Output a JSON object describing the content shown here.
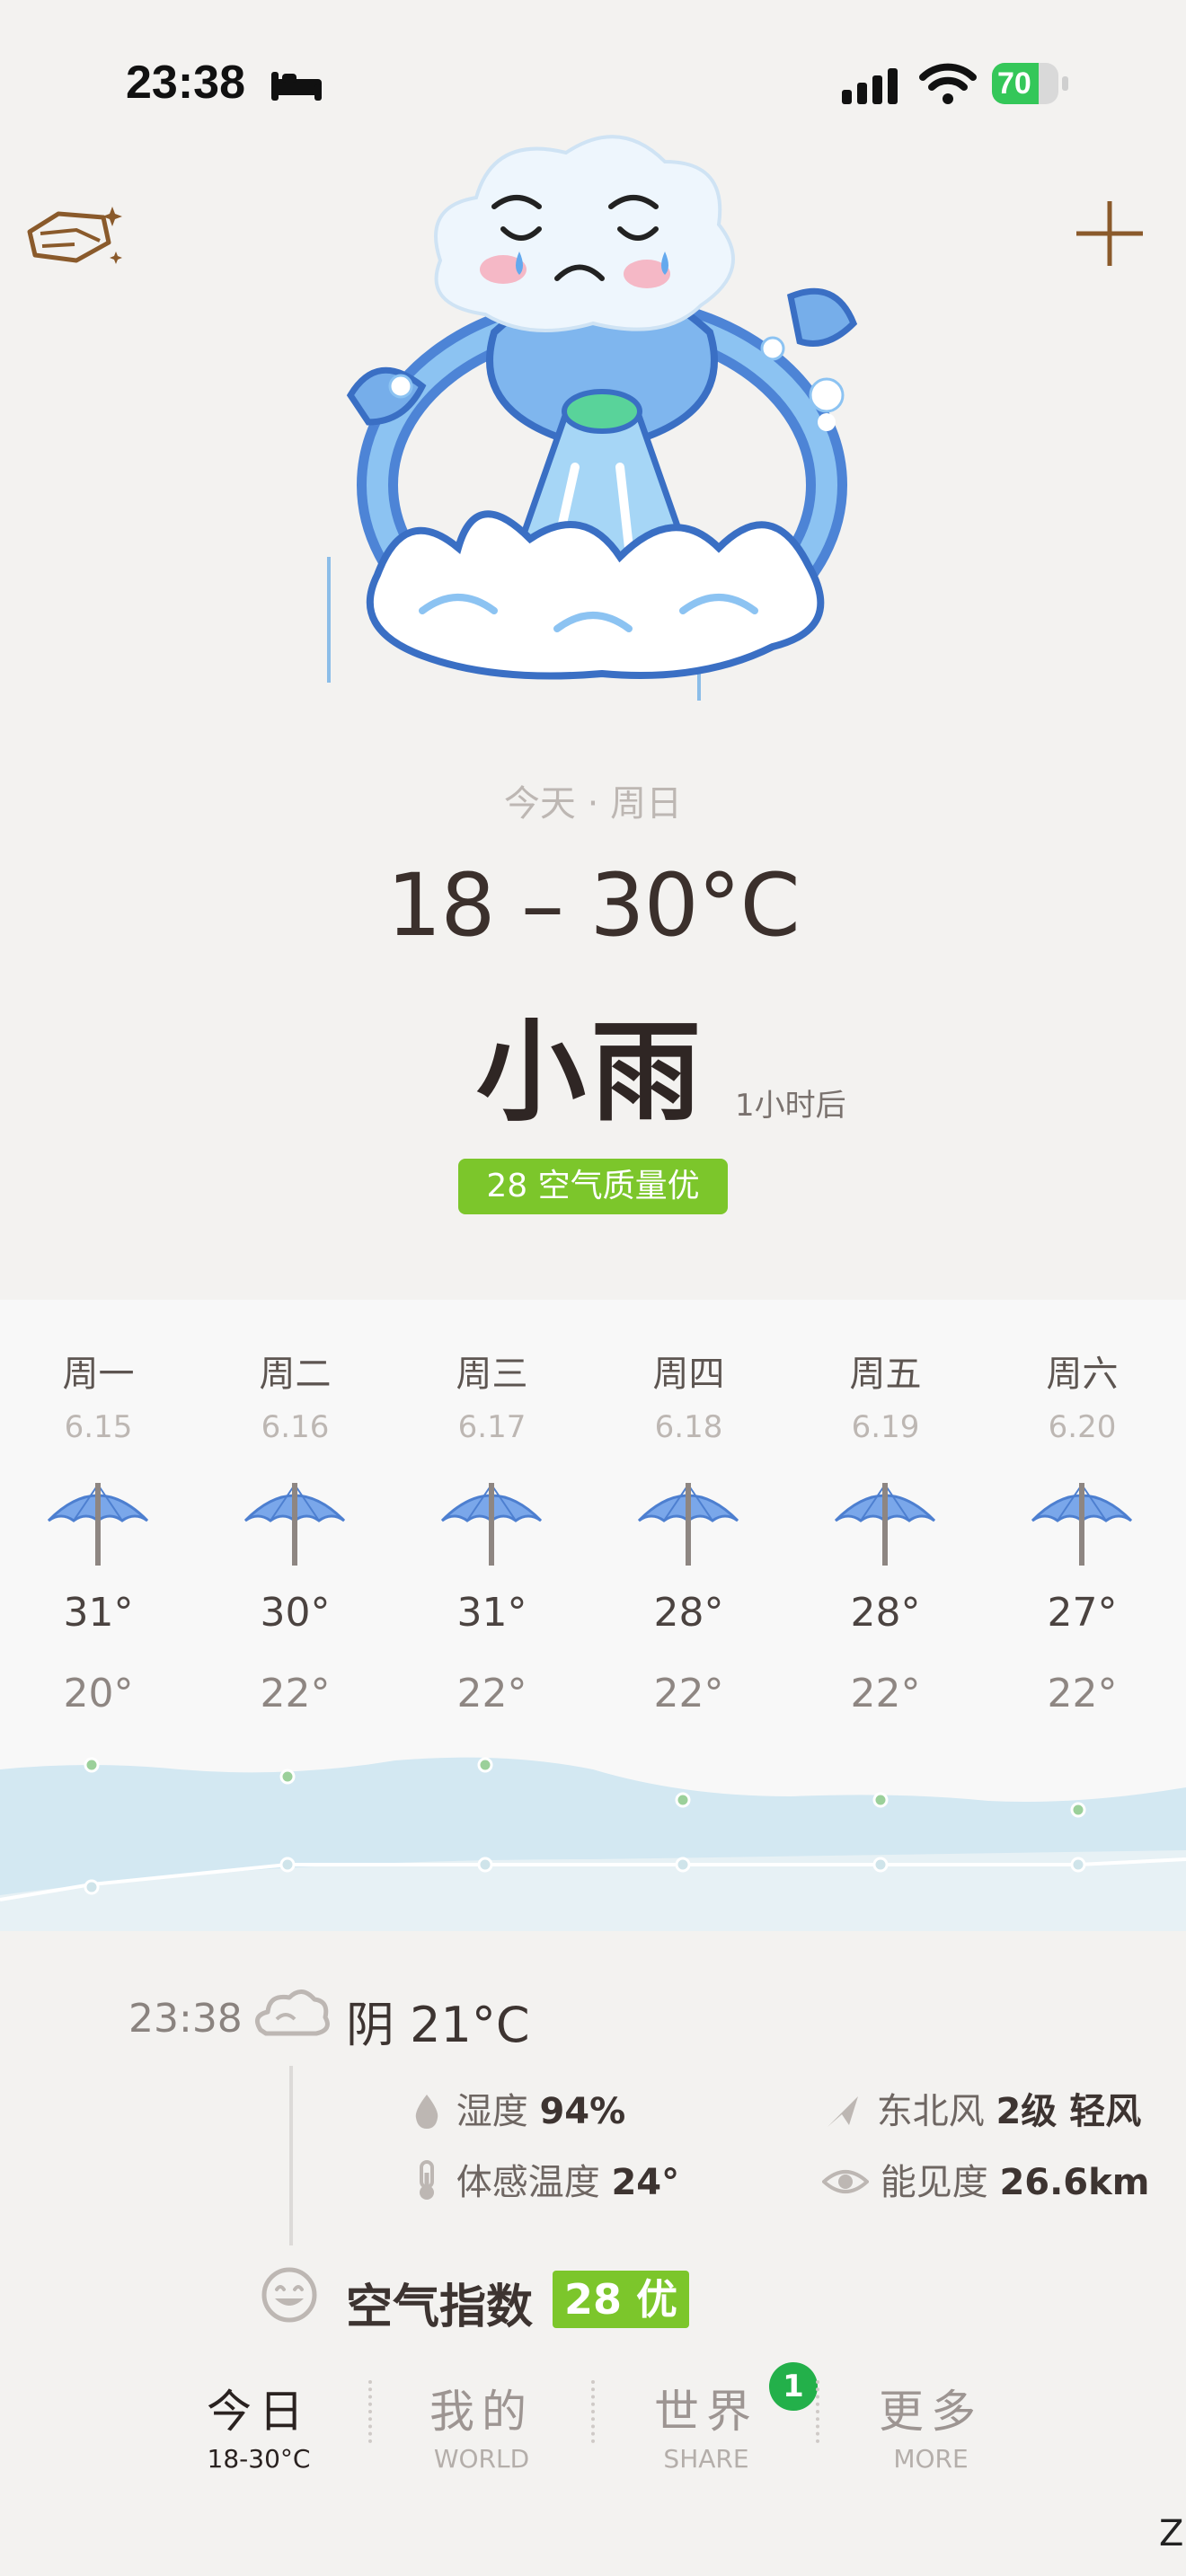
{
  "status_bar": {
    "time": "23:38",
    "battery": "70",
    "battery_level": 0.7,
    "icons": [
      "bed-icon",
      "signal-icon",
      "wifi-icon",
      "battery-icon"
    ]
  },
  "header": {
    "left_icon": "theme-icon",
    "right_icon": "plus-icon"
  },
  "today": {
    "label": "今天 · 周日",
    "temp_range": "18 – 30°C",
    "condition": "小雨",
    "condition_note": "1小时后",
    "aqi_badge": "28 空气质量优"
  },
  "forecast": [
    {
      "day": "周一",
      "date": "6.15",
      "high": "31°",
      "low": "20°",
      "icon": "umbrella-icon"
    },
    {
      "day": "周二",
      "date": "6.16",
      "high": "30°",
      "low": "22°",
      "icon": "umbrella-icon"
    },
    {
      "day": "周三",
      "date": "6.17",
      "high": "31°",
      "low": "22°",
      "icon": "umbrella-icon"
    },
    {
      "day": "周四",
      "date": "6.18",
      "high": "28°",
      "low": "22°",
      "icon": "umbrella-icon"
    },
    {
      "day": "周五",
      "date": "6.19",
      "high": "28°",
      "low": "22°",
      "icon": "umbrella-icon"
    },
    {
      "day": "周六",
      "date": "6.20",
      "high": "27°",
      "low": "22°",
      "icon": "umbrella-icon"
    }
  ],
  "current": {
    "time": "23:38",
    "condition": "阴 21°C",
    "humidity_label": "湿度",
    "humidity_value": "94%",
    "feels_label": "体感温度",
    "feels_value": "24°",
    "wind_label": "东北风",
    "wind_value": "2级 轻风",
    "visibility_label": "能见度",
    "visibility_value": "26.6km",
    "aqi_title": "空气指数",
    "aqi_value": "28 优"
  },
  "tabs": [
    {
      "label": "今日",
      "sub": "18-30°C",
      "active": true
    },
    {
      "label": "我的",
      "sub": "WORLD",
      "active": false
    },
    {
      "label": "世界",
      "sub": "SHARE",
      "active": false,
      "badge": "1"
    },
    {
      "label": "更多",
      "sub": "MORE",
      "active": false
    }
  ],
  "home_indicator": "Z",
  "colors": {
    "aqi_green": "#7cc62b",
    "badge_green": "#23b04a",
    "umbrella_blue": "#7aa7ea",
    "accent_brown": "#8a5a2b"
  }
}
